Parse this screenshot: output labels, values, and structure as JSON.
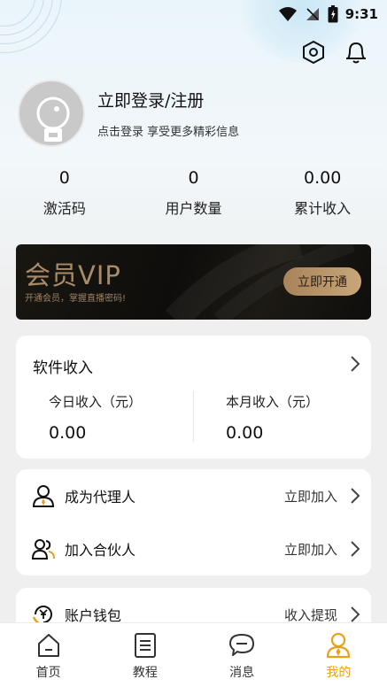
{
  "status_bar": {
    "time": "9:31"
  },
  "header": {
    "settings_icon": "hexagon-settings-icon",
    "notification_icon": "bell-icon"
  },
  "profile": {
    "title": "立即登录/注册",
    "subtitle": "点击登录 享受更多精彩信息"
  },
  "stats": [
    {
      "value": "0",
      "label": "激活码"
    },
    {
      "value": "0",
      "label": "用户数量"
    },
    {
      "value": "0.00",
      "label": "累计收入"
    }
  ],
  "vip": {
    "title": "会员VIP",
    "subtitle": "开通会员，掌握直播密码!",
    "button": "立即开通",
    "accent": "#a88c68"
  },
  "income": {
    "title": "软件收入",
    "today_label": "今日收入（元）",
    "today_value": "0.00",
    "month_label": "本月收入（元）",
    "month_value": "0.00"
  },
  "list": [
    {
      "label": "成为代理人",
      "action": "立即加入",
      "icon": "agent-person-icon"
    },
    {
      "label": "加入合伙人",
      "action": "立即加入",
      "icon": "partners-icon"
    }
  ],
  "wallet": {
    "label": "账户钱包",
    "action": "收入提现",
    "icon": "wallet-yen-icon"
  },
  "tabs": [
    {
      "label": "首页",
      "icon": "home-icon"
    },
    {
      "label": "教程",
      "icon": "document-icon"
    },
    {
      "label": "消息",
      "icon": "message-icon"
    },
    {
      "label": "我的",
      "icon": "profile-icon",
      "active": true
    }
  ],
  "colors": {
    "active_tab": "#e8a21a",
    "icon_accent": "#e8a21a"
  }
}
